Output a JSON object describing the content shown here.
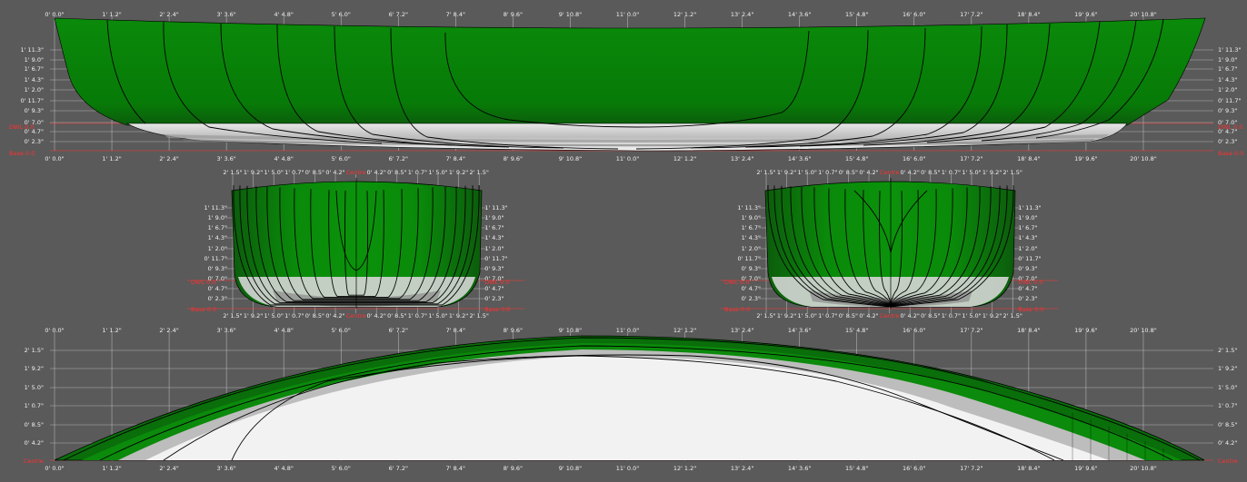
{
  "colors": {
    "background": "#5a5a5a",
    "hull_green": "#0a8a0a",
    "hull_dark": "#0c5c0c",
    "hull_white": "#f2f2f2",
    "grid": "#d8d8d8",
    "tick_text": "#f2f2f2",
    "reference_text": "#ff3030",
    "section_line": "#000000"
  },
  "profile": {
    "x_ticks": [
      "0' 0.0\"",
      "1' 1.2\"",
      "2' 2.4\"",
      "3' 3.6\"",
      "4' 4.8\"",
      "5' 6.0\"",
      "6' 7.2\"",
      "7' 8.4\"",
      "8' 9.6\"",
      "9' 10.8\"",
      "11' 0.0\"",
      "12' 1.2\"",
      "13' 2.4\"",
      "14' 3.6\"",
      "15' 4.8\"",
      "16' 6.0\"",
      "17' 7.2\"",
      "18' 8.4\"",
      "19' 9.6\"",
      "20' 10.8\""
    ],
    "y_ticks": [
      "1' 11.3\"",
      "1' 9.0\"",
      "1' 6.7\"",
      "1' 4.3\"",
      "1' 2.0\"",
      "0' 11.7\"",
      "0' 9.3\"",
      "0' 7.0\"",
      "0' 4.7\"",
      "0' 2.3\""
    ],
    "dwl_label": "DWL 0.0",
    "base_label": "Base 0.0",
    "dwl_label_right": "DWL 0.0",
    "base_label_right": "Base 0.0"
  },
  "body_plans": {
    "h_ticks": [
      "2' 1.5\"",
      "1' 9.2\"",
      "1' 5.0\"",
      "1' 0.7\"",
      "0' 8.5\"",
      "0' 4.2\"",
      "Centre",
      "0' 4.2\"",
      "0' 8.5\"",
      "1' 0.7\"",
      "1' 5.0\"",
      "1' 9.2\"",
      "2' 1.5\""
    ],
    "y_ticks": [
      "1' 11.3\"",
      "1' 9.0\"",
      "1' 6.7\"",
      "1' 4.3\"",
      "1' 2.0\"",
      "0' 11.7\"",
      "0' 9.3\"",
      "0' 7.0\"",
      "0' 4.7\"",
      "0' 2.3\""
    ],
    "dwl_label": "DWL 0.0",
    "base_label": "Base 0.0"
  },
  "plan": {
    "x_ticks": [
      "0' 0.0\"",
      "1' 1.2\"",
      "2' 2.4\"",
      "3' 3.6\"",
      "4' 4.8\"",
      "5' 6.0\"",
      "6' 7.2\"",
      "7' 8.4\"",
      "8' 9.6\"",
      "9' 10.8\"",
      "11' 0.0\"",
      "12' 1.2\"",
      "13' 2.4\"",
      "14' 3.6\"",
      "15' 4.8\"",
      "16' 6.0\"",
      "17' 7.2\"",
      "18' 8.4\"",
      "19' 9.6\"",
      "20' 10.8\""
    ],
    "y_ticks": [
      "2' 1.5\"",
      "1' 9.2\"",
      "1' 5.0\"",
      "1' 0.7\"",
      "0' 8.5\"",
      "0' 4.2\""
    ],
    "centre_label": "Centre",
    "centre_label_right": "Centre"
  }
}
